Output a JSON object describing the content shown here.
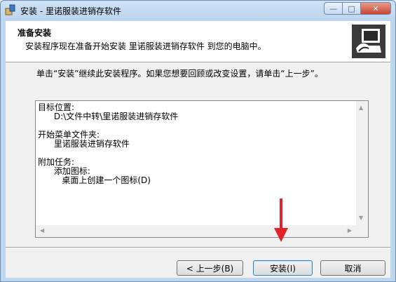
{
  "window": {
    "title": "安装 - 里诺服装进销存软件",
    "controls": {
      "minimize": "—",
      "maximize": "□",
      "close": "✕"
    }
  },
  "header": {
    "heading": "准备安装",
    "subheading": "安装程序现在准备开始安装 里诺服装进销存软件 到您的电脑中。"
  },
  "description": "单击“安装”继续此安装程序。如果您想要回顾或改变设置，请单击“上一步”。",
  "summary_text": "目标位置:\n      D:\\文件中转\\里诺服装进销存软件\n\n开始菜单文件夹:\n      里诺服装进销存软件\n\n附加任务:\n      添加图标:\n         桌面上创建一个图标(D)",
  "buttons": {
    "back": "< 上一步(B)",
    "install": "安装(I)",
    "cancel": "取消"
  },
  "colors": {
    "annotation_arrow": "#e0242a",
    "title_bar": "#bcd4ee"
  },
  "icons": {
    "app": "installer-box-icon",
    "logo": "computer-install-icon"
  }
}
